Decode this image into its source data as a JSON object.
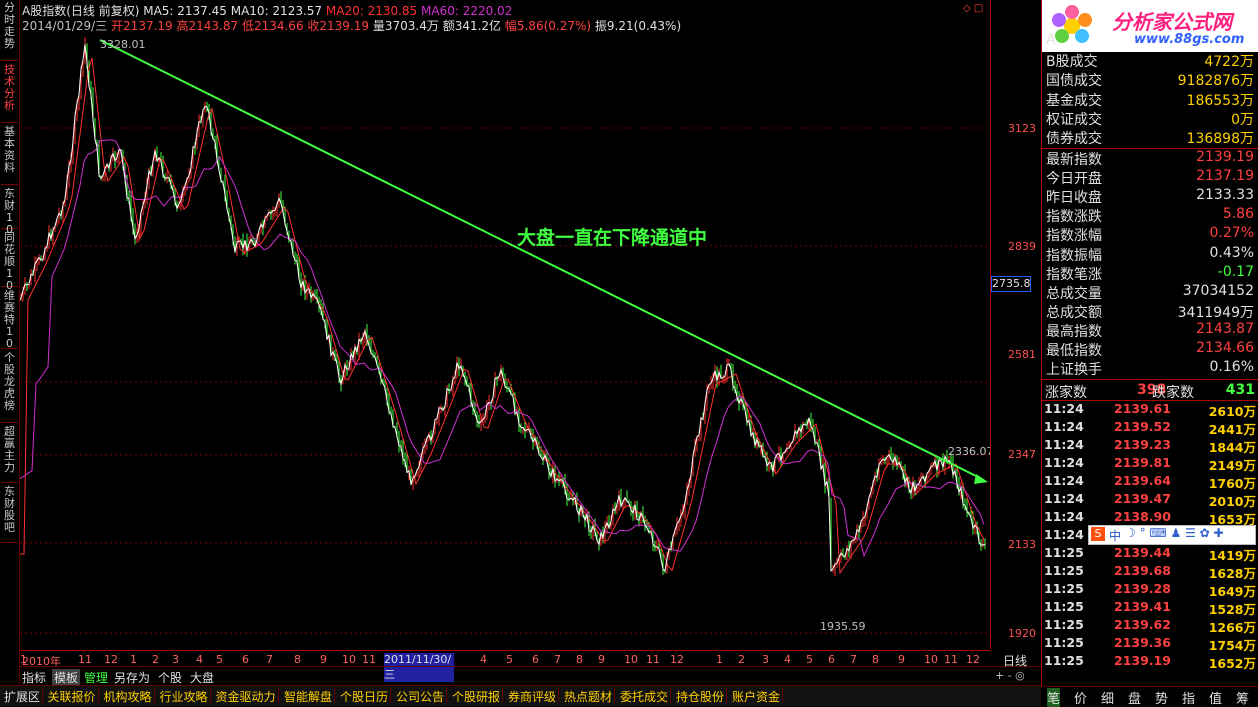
{
  "left_tabs": [
    "分时走势",
    "技术分析",
    "基本资料",
    "东财10",
    "同花顺10",
    "维赛特10",
    "个股龙虎榜",
    "超赢主力",
    "东财股吧"
  ],
  "header": {
    "line1": {
      "title": "A股指数(日线 前复权)",
      "ma5": "MA5: 2137.45",
      "ma10": "MA10: 2123.57",
      "ma20": "MA20: 2130.85",
      "ma60": "MA60: 2220.02"
    },
    "line2": {
      "date": "2014/01/29/三",
      "open": "开2137.19",
      "high": "高2143.87",
      "low": "低2134.66",
      "close": "收2139.19",
      "vol": "量3703.4万",
      "amount": "额341.2亿",
      "change": "幅5.86(0.27%)",
      "amp": "振9.21(0.43%)"
    }
  },
  "annotations": {
    "peak_high": "3328.01",
    "low_point": "1935.59",
    "recent_high": "2336.07",
    "trend_text": "大盘一直在下降通道中"
  },
  "y_axis": {
    "ticks": [
      "3123",
      "2839",
      "2581",
      "2347",
      "2133",
      "1920"
    ],
    "current": "2735.8"
  },
  "x_axis": {
    "labels": [
      "2010年",
      "11",
      "12",
      "1",
      "2",
      "3",
      "4",
      "5",
      "6",
      "7",
      "8",
      "9",
      "10",
      "11",
      "2011/11/30/三",
      "4",
      "5",
      "6",
      "7",
      "8",
      "9",
      "10",
      "11",
      "12",
      "1",
      "2",
      "3",
      "4",
      "5",
      "6",
      "7",
      "8",
      "9",
      "10",
      "11",
      "12",
      "1"
    ],
    "period": "日线"
  },
  "toolbar1": [
    "指标",
    "模板",
    "管理",
    "另存为",
    "个股",
    "大盘"
  ],
  "toolbar2": [
    "扩展区",
    "关联报价",
    "机构攻略",
    "行业攻略",
    "资金驱动力",
    "智能解盘",
    "个股日历",
    "公司公告",
    "个股研报",
    "券商评级",
    "热点题材",
    "委托成交",
    "持仓股份",
    "账户资金"
  ],
  "logo": {
    "brand": "分析家公式网",
    "url": "www.88gs.com"
  },
  "stats_top": [
    {
      "label": "A",
      "value": ""
    },
    {
      "label": "B股成交",
      "value": "4722万"
    },
    {
      "label": "国债成交",
      "value": "9182876万"
    },
    {
      "label": "基金成交",
      "value": "186553万"
    },
    {
      "label": "权证成交",
      "value": "0万"
    },
    {
      "label": "债券成交",
      "value": "136898万"
    }
  ],
  "stats_index": [
    {
      "label": "最新指数",
      "value": "2139.19",
      "color": "#ff4040"
    },
    {
      "label": "今日开盘",
      "value": "2137.19",
      "color": "#ff4040"
    },
    {
      "label": "昨日收盘",
      "value": "2133.33",
      "color": "#e0e0e0"
    },
    {
      "label": "指数涨跌",
      "value": "5.86",
      "color": "#ff4040"
    },
    {
      "label": "指数涨幅",
      "value": "0.27%",
      "color": "#ff4040"
    },
    {
      "label": "指数振幅",
      "value": "0.43%",
      "color": "#e0e0e0"
    },
    {
      "label": "指数笔涨",
      "value": "-0.17",
      "color": "#40ff40"
    },
    {
      "label": "总成交量",
      "value": "37034152",
      "color": "#e0e0e0"
    },
    {
      "label": "总成交额",
      "value": "3411949万",
      "color": "#e0e0e0"
    },
    {
      "label": "最高指数",
      "value": "2143.87",
      "color": "#ff4040"
    },
    {
      "label": "最低指数",
      "value": "2134.66",
      "color": "#ff4040"
    },
    {
      "label": "上证换手",
      "value": "0.16%",
      "color": "#e0e0e0"
    }
  ],
  "updown": {
    "up_label": "涨家数",
    "up": "398",
    "down_label": "跌家数",
    "down": "431"
  },
  "ticks": [
    {
      "t": "11:24",
      "p": "2139.61",
      "q": "2610万"
    },
    {
      "t": "11:24",
      "p": "2139.52",
      "q": "2441万"
    },
    {
      "t": "11:24",
      "p": "2139.23",
      "q": "1844万"
    },
    {
      "t": "11:24",
      "p": "2139.81",
      "q": "2149万"
    },
    {
      "t": "11:24",
      "p": "2139.64",
      "q": "1760万"
    },
    {
      "t": "11:24",
      "p": "2139.47",
      "q": "2010万"
    },
    {
      "t": "11:24",
      "p": "2138.90",
      "q": "1653万"
    },
    {
      "t": "11:24",
      "p": "",
      "q": ""
    },
    {
      "t": "11:25",
      "p": "2139.44",
      "q": "1419万"
    },
    {
      "t": "11:25",
      "p": "2139.68",
      "q": "1628万"
    },
    {
      "t": "11:25",
      "p": "2139.28",
      "q": "1649万"
    },
    {
      "t": "11:25",
      "p": "2139.41",
      "q": "1528万"
    },
    {
      "t": "11:25",
      "p": "2139.62",
      "q": "1266万"
    },
    {
      "t": "11:25",
      "p": "2139.36",
      "q": "1754万"
    },
    {
      "t": "11:25",
      "p": "2139.19",
      "q": "1652万"
    }
  ],
  "right_tabs": [
    "笔",
    "价",
    "细",
    "盘",
    "势",
    "指",
    "值",
    "筹"
  ],
  "ime": {
    "label": "中"
  }
}
